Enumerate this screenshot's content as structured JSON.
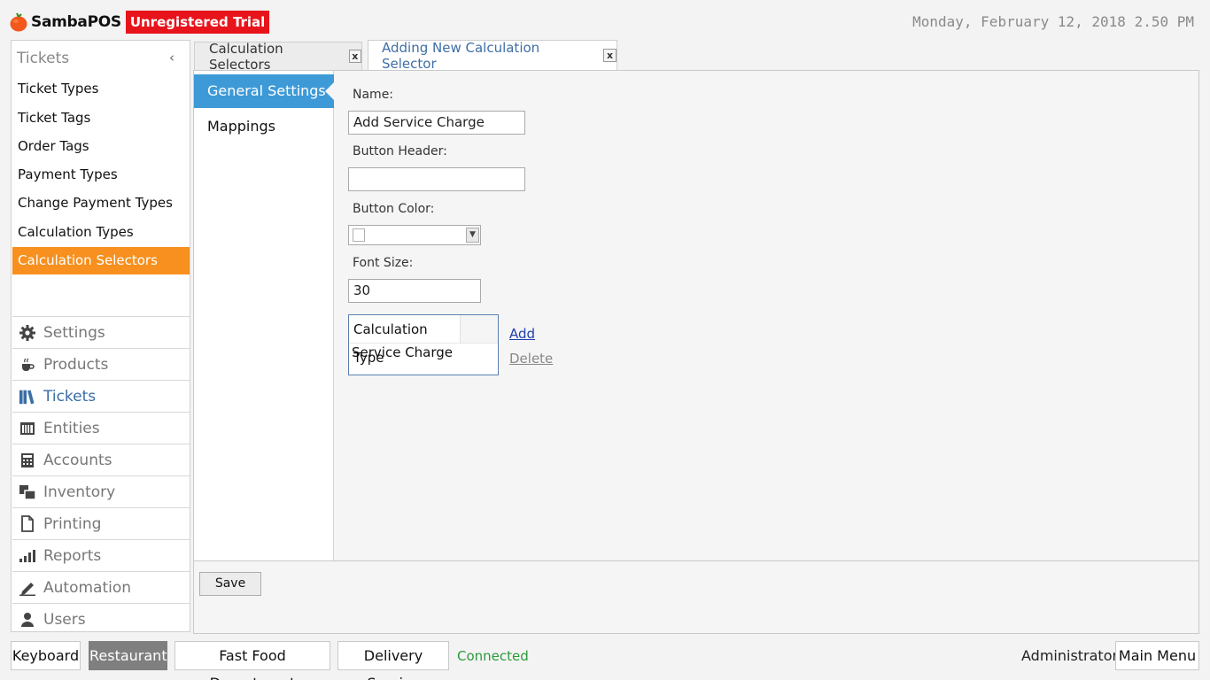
{
  "header": {
    "app_name": "SambaPOS",
    "trial_label": "Unregistered Trial",
    "datetime": "Monday, February 12, 2018 2.50 PM"
  },
  "sidebar": {
    "title": "Tickets",
    "collapse_glyph": "‹",
    "sub_items": [
      {
        "label": "Ticket Types"
      },
      {
        "label": "Ticket Tags"
      },
      {
        "label": "Order Tags"
      },
      {
        "label": "Payment Types"
      },
      {
        "label": "Change Payment Types"
      },
      {
        "label": "Calculation Types"
      },
      {
        "label": "Calculation Selectors",
        "active": true
      }
    ],
    "main_nav": [
      {
        "label": "Settings",
        "icon": "gear-icon"
      },
      {
        "label": "Products",
        "icon": "coffee-cup-icon"
      },
      {
        "label": "Tickets",
        "icon": "books-icon",
        "active": true
      },
      {
        "label": "Entities",
        "icon": "table-grid-icon"
      },
      {
        "label": "Accounts",
        "icon": "calculator-icon"
      },
      {
        "label": "Inventory",
        "icon": "boxes-icon"
      },
      {
        "label": "Printing",
        "icon": "document-icon"
      },
      {
        "label": "Reports",
        "icon": "bar-chart-icon"
      },
      {
        "label": "Automation",
        "icon": "pencil-icon"
      },
      {
        "label": "Users",
        "icon": "user-icon"
      }
    ]
  },
  "tabs": [
    {
      "label": "Calculation Selectors",
      "close": "x"
    },
    {
      "label": "Adding New Calculation Selector",
      "close": "x",
      "active": true
    }
  ],
  "settings_nav": {
    "general": "General Settings",
    "mappings": "Mappings"
  },
  "form": {
    "name_label": "Name:",
    "name_value": "Add Service Charge",
    "button_header_label": "Button Header:",
    "button_header_value": "",
    "button_color_label": "Button Color:",
    "font_size_label": "Font Size:",
    "font_size_value": "30",
    "grid_header": "Calculation Type",
    "grid_row": "Service Charge",
    "add_link": "Add",
    "delete_link": "Delete",
    "save_label": "Save"
  },
  "bottom_bar": {
    "keyboard": "Keyboard",
    "restaurant": "Restaurant",
    "fast_food": "Fast Food Department",
    "delivery": "Delivery Service",
    "status": "Connected",
    "user": "Administrator",
    "main_menu": "Main Menu"
  },
  "colors": {
    "accent_orange": "#f7901e",
    "accent_blue": "#3d9ad7",
    "trial_red": "#e8141b",
    "connected_green": "#2d9a3c"
  }
}
